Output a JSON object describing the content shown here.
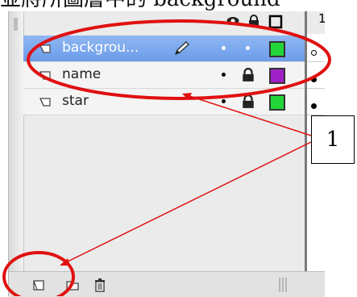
{
  "caption": {
    "text": "並將所圖層中的 background"
  },
  "panel": {
    "header": {
      "eye_icon": "eye-icon",
      "lock_icon": "lock-icon",
      "outline_icon": "outline-icon",
      "frame_number": "1"
    },
    "layers": [
      {
        "name": "backgrou...",
        "selected": true,
        "icon": "layer-icon",
        "editing_icon": "pencil-icon",
        "visible_state": "dot",
        "lock_state": "dot",
        "outline_color": "#22d63a",
        "frame_marker": "hollow-keyframe"
      },
      {
        "name": "name",
        "selected": false,
        "icon": "layer-icon",
        "visible_state": "dot",
        "lock_state": "locked",
        "outline_color": "#a020c8",
        "frame_marker": "keyframe"
      },
      {
        "name": "star",
        "selected": false,
        "icon": "layer-icon",
        "visible_state": "dot",
        "lock_state": "locked",
        "outline_color": "#22d63a",
        "frame_marker": "keyframe"
      }
    ],
    "bottom_toolbar": {
      "new_layer_icon": "new-layer-icon",
      "new_folder_icon": "new-folder-icon",
      "delete_icon": "trash-icon"
    }
  },
  "annotation": {
    "callout_label": "1",
    "highlight_color": "#e01010",
    "arrow_color": "#e01010"
  }
}
